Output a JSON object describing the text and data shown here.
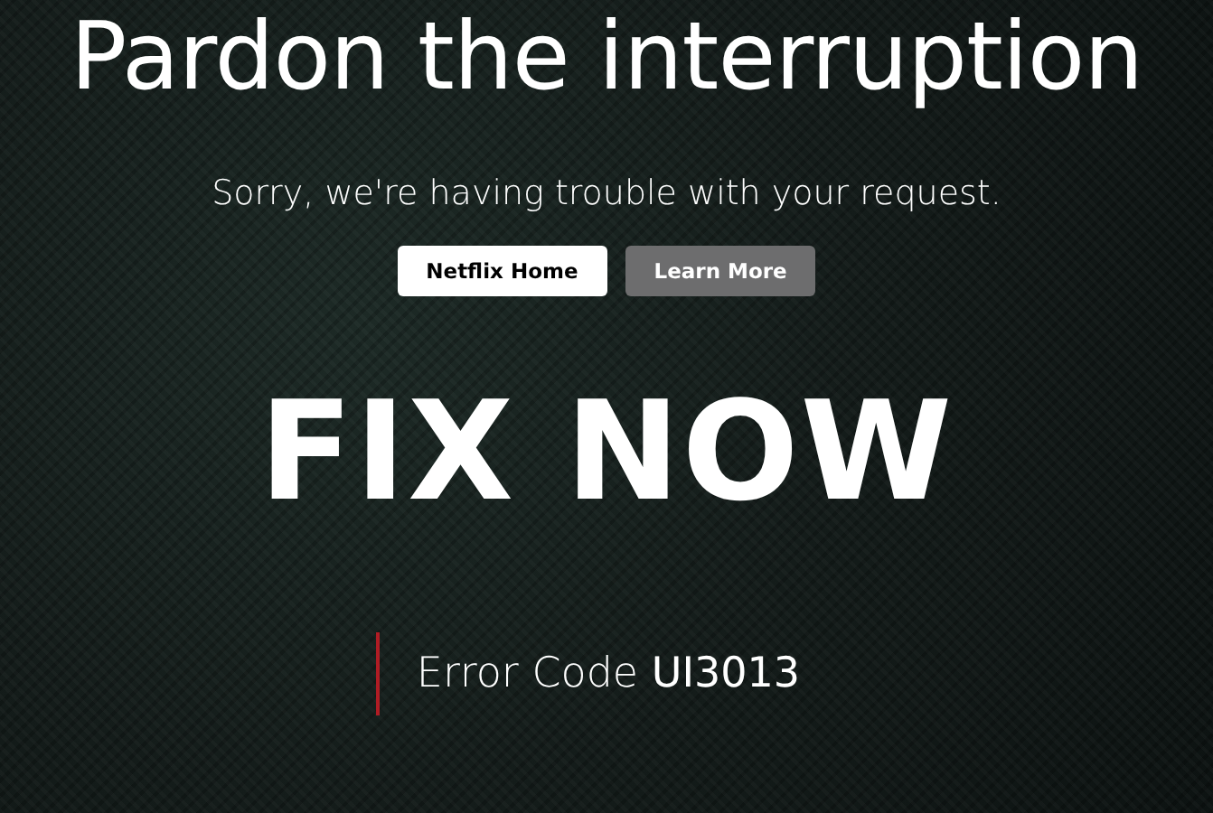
{
  "title": "Pardon the interruption",
  "message": "Sorry, we're having trouble with your request.",
  "buttons": [
    {
      "label": "Netflix Home",
      "kind": "primary"
    },
    {
      "label": "Learn More",
      "kind": "secondary"
    }
  ],
  "banner": "FIX NOW",
  "error_code": "Error Code **UI3013**"
}
